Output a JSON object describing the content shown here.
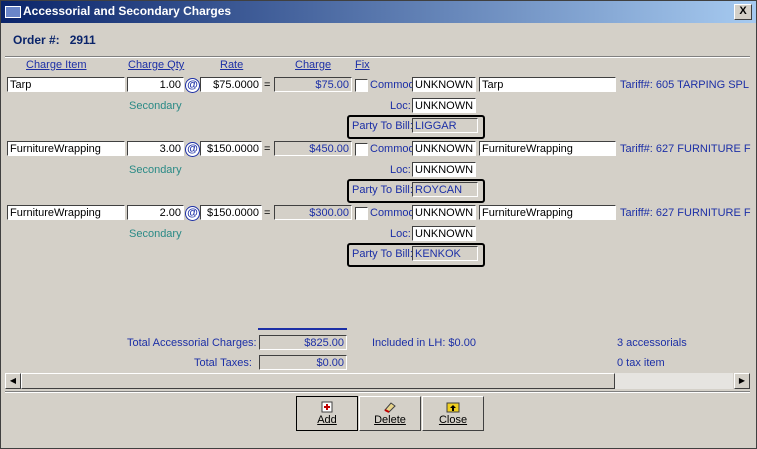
{
  "window": {
    "title": "Accessorial and Secondary Charges",
    "close_glyph": "X"
  },
  "order": {
    "label": "Order #:",
    "number": "2911"
  },
  "headers": {
    "charge_item": "Charge Item",
    "charge_qty": "Charge Qty",
    "rate": "Rate",
    "charge": "Charge",
    "fix": "Fix"
  },
  "rows": [
    {
      "item": "Tarp",
      "qty": "1.00",
      "rate": "$75.0000",
      "charge": "$75.00",
      "commod_label": "Commod:",
      "commod": "UNKNOWN",
      "description": "Tarp",
      "tariff": "Tariff#: 605 TARPING SPL",
      "type": "Secondary",
      "loc_label": "Loc:",
      "loc": "UNKNOWN",
      "ptb_label": "Party To Bill:",
      "ptb": "LIGGAR"
    },
    {
      "item": "FurnitureWrapping",
      "qty": "3.00",
      "rate": "$150.0000",
      "charge": "$450.00",
      "commod_label": "Commod:",
      "commod": "UNKNOWN",
      "description": "FurnitureWrapping",
      "tariff": "Tariff#: 627 FURNITURE F",
      "type": "Secondary",
      "loc_label": "Loc:",
      "loc": "UNKNOWN",
      "ptb_label": "Party To Bill:",
      "ptb": "ROYCAN"
    },
    {
      "item": "FurnitureWrapping",
      "qty": "2.00",
      "rate": "$150.0000",
      "charge": "$300.00",
      "commod_label": "Commod:",
      "commod": "UNKNOWN",
      "description": "FurnitureWrapping",
      "tariff": "Tariff#: 627 FURNITURE F",
      "type": "Secondary",
      "loc_label": "Loc:",
      "loc": "UNKNOWN",
      "ptb_label": "Party To Bill:",
      "ptb": "KENKOK"
    }
  ],
  "at_glyph": "@",
  "eq_glyph": "=",
  "totals": {
    "accessorial_label": "Total Accessorial Charges:",
    "accessorial_value": "$825.00",
    "taxes_label": "Total Taxes:",
    "taxes_value": "$0.00",
    "included_lh": "Included in LH: $0.00",
    "accessorial_count": "3 accessorials",
    "tax_count": "0 tax item"
  },
  "buttons": {
    "add": "Add",
    "delete": "Delete",
    "close": "Close"
  },
  "scrollbar": {
    "left_glyph": "◀",
    "right_glyph": "▶"
  },
  "colors": {
    "title_bar": "#0a246a",
    "label_blue": "#1c2fa6",
    "secondary_teal": "#2a8a86",
    "window_bg": "#d4d0c8"
  }
}
